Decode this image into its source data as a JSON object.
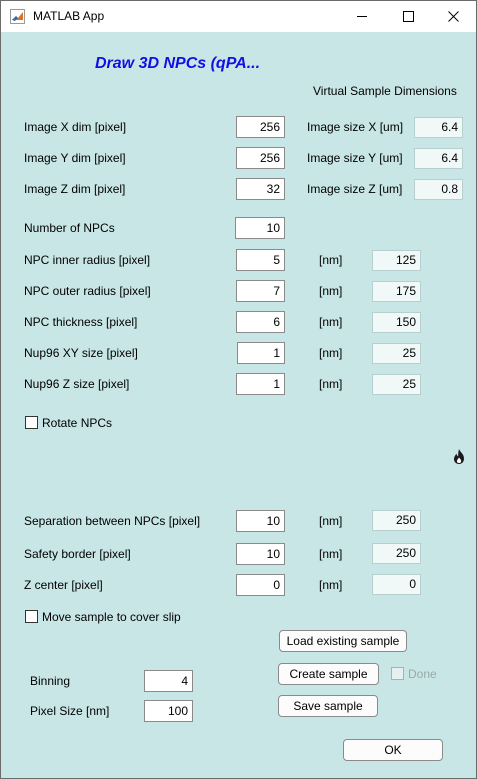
{
  "window": {
    "title": "MATLAB App"
  },
  "header": {
    "title": "Draw 3D NPCs (qPA...",
    "virtual_dims_label": "Virtual Sample Dimensions"
  },
  "dims": [
    {
      "label": "Image X dim [pixel]",
      "value": "256",
      "size_label": "Image size X [um]",
      "size_value": "6.4"
    },
    {
      "label": "Image Y dim [pixel]",
      "value": "256",
      "size_label": "Image size Y [um]",
      "size_value": "6.4"
    },
    {
      "label": "Image Z dim [pixel]",
      "value": "32",
      "size_label": "Image size Z [um]",
      "size_value": "0.8"
    }
  ],
  "num_npcs": {
    "label": "Number of NPCs",
    "value": "10"
  },
  "npc_params": [
    {
      "label": "NPC inner radius [pixel]",
      "value": "5",
      "unit": "[nm]",
      "nm_value": "125"
    },
    {
      "label": "NPC outer radius [pixel]",
      "value": "7",
      "unit": "[nm]",
      "nm_value": "175"
    },
    {
      "label": "NPC thickness [pixel]",
      "value": "6",
      "unit": "[nm]",
      "nm_value": "150"
    },
    {
      "label": "Nup96 XY size [pixel]",
      "value": "1",
      "unit": "[nm]",
      "nm_value": "25"
    },
    {
      "label": "Nup96 Z size [pixel]",
      "value": "1",
      "unit": "[nm]",
      "nm_value": "25"
    }
  ],
  "rotate": {
    "label": "Rotate NPCs",
    "checked": false
  },
  "placement": [
    {
      "label": "Separation between NPCs [pixel]",
      "value": "10",
      "unit": "[nm]",
      "nm_value": "250"
    },
    {
      "label": "Safety border [pixel]",
      "value": "10",
      "unit": "[nm]",
      "nm_value": "250"
    },
    {
      "label": "Z center [pixel]",
      "value": "0",
      "unit": "[nm]",
      "nm_value": "0"
    }
  ],
  "move_sample": {
    "label": "Move sample to cover slip",
    "checked": false
  },
  "binning": {
    "label": "Binning",
    "value": "4"
  },
  "pixel_size": {
    "label": "Pixel Size [nm]",
    "value": "100"
  },
  "buttons": {
    "load": "Load existing sample",
    "create": "Create sample",
    "save": "Save sample",
    "ok": "OK"
  },
  "done": {
    "label": "Done",
    "checked": false,
    "disabled": true
  },
  "icons": {
    "app": "matlab-icon",
    "flame": "flame-icon",
    "minimize": "minimize-icon",
    "maximize": "maximize-icon",
    "close": "close-icon"
  },
  "colors": {
    "background": "#c9e6e6",
    "heading": "#1010e6"
  }
}
